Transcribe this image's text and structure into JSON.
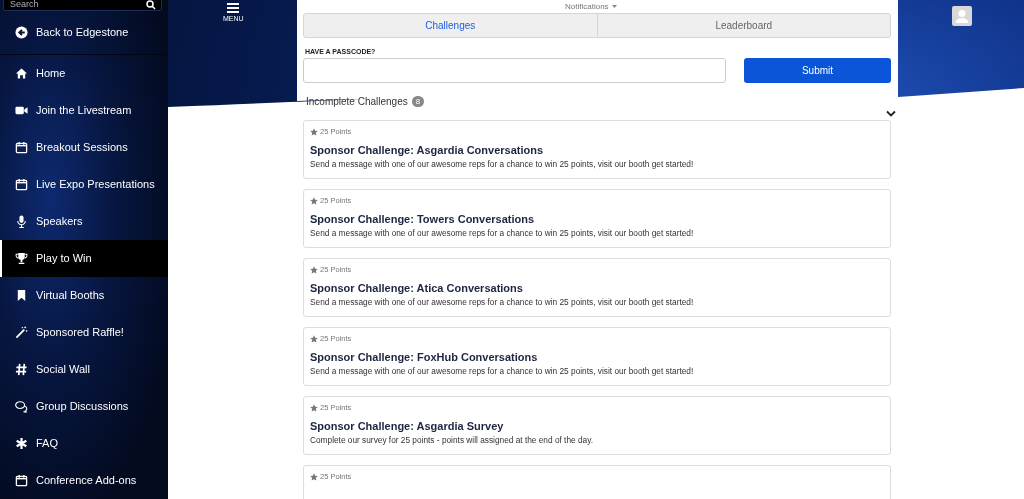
{
  "sidebar": {
    "search": {
      "placeholder": "Search"
    },
    "back_link": "Back to Edgestone",
    "items": [
      {
        "label": "Home",
        "selected": false
      },
      {
        "label": "Join the Livestream",
        "selected": false
      },
      {
        "label": "Breakout Sessions",
        "selected": false
      },
      {
        "label": "Live Expo Presentations",
        "selected": false
      },
      {
        "label": "Speakers",
        "selected": false
      },
      {
        "label": "Play to Win",
        "selected": true
      },
      {
        "label": "Virtual Booths",
        "selected": false
      },
      {
        "label": "Sponsored Raffle!",
        "selected": false
      },
      {
        "label": "Social Wall",
        "selected": false
      },
      {
        "label": "Group Discussions",
        "selected": false
      },
      {
        "label": "FAQ",
        "selected": false
      },
      {
        "label": "Conference Add-ons",
        "selected": false
      }
    ]
  },
  "header": {
    "menu_label": "MENU",
    "notifications": "Notifications"
  },
  "tabs": [
    {
      "label": "Challenges",
      "selected": true
    },
    {
      "label": "Leaderboard",
      "selected": false
    }
  ],
  "passcode": {
    "label": "HAVE A PASSCODE?",
    "button": "Submit"
  },
  "section": {
    "title": "Incomplete Challenges",
    "count": "8",
    "expanded": true
  },
  "challenges": [
    {
      "points": "25 Points",
      "title": "Sponsor Challenge: Asgardia Conversations",
      "description": "Send a message with one of our awesome reps for a chance to win 25 points, visit our booth get started!"
    },
    {
      "points": "25 Points",
      "title": "Sponsor Challenge: Towers Conversations",
      "description": "Send a message with one of our awesome reps for a chance to win 25 points, visit our booth get started!"
    },
    {
      "points": "25 Points",
      "title": "Sponsor Challenge: Atica Conversations",
      "description": "Send a message with one of our awesome reps for a chance to win 25 points, visit our booth get started!"
    },
    {
      "points": "25 Points",
      "title": "Sponsor Challenge: FoxHub Conversations",
      "description": "Send a message with one of our awesome reps for a chance to win 25 points, visit our booth get started!"
    },
    {
      "points": "25 Points",
      "title": "Sponsor Challenge: Asgardia Survey",
      "description": "Complete our survey for 25 points - points will assigned at the end of the day."
    },
    {
      "points": "25 Points"
    }
  ]
}
